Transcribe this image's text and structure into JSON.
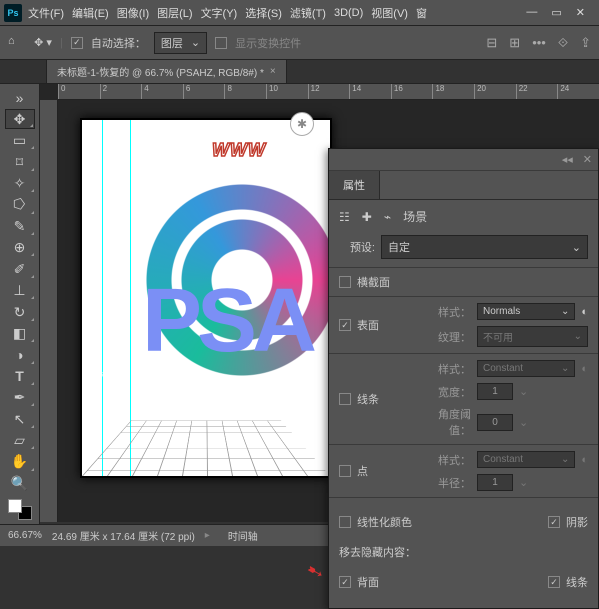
{
  "menu": {
    "file": "文件(F)",
    "edit": "编辑(E)",
    "image": "图像(I)",
    "layer": "图层(L)",
    "type": "文字(Y)",
    "select": "选择(S)",
    "filter": "滤镜(T)",
    "threeD": "3D(D)",
    "view": "视图(V)",
    "window": "窗"
  },
  "opt": {
    "autoSelect": "自动选择：",
    "target": "图层",
    "showTransform": "显示变换控件"
  },
  "tab": {
    "title": "未标题-1-恢复的 @ 66.7% (PSAHZ, RGB/8#) *"
  },
  "ruler": {
    "m": [
      "0",
      "2",
      "4",
      "6",
      "8",
      "10",
      "12",
      "14",
      "16",
      "18",
      "20",
      "22",
      "24"
    ]
  },
  "canvas": {
    "url": "WWW",
    "psa": "PSA",
    "spot": "✱"
  },
  "status": {
    "zoom": "66.67%",
    "dims": "24.69 厘米 x 17.64 厘米 (72 ppi)",
    "timeline": "时间轴"
  },
  "panel": {
    "title": "属性",
    "scene": "场景",
    "presetLabel": "预设:",
    "presetValue": "自定",
    "section": {
      "label": "横截面"
    },
    "surface": {
      "label": "表面",
      "styleLabel": "样式：",
      "styleValue": "Normals",
      "textureLabel": "纹理：",
      "textureValue": "不可用"
    },
    "lines": {
      "label": "线条",
      "styleLabel": "样式：",
      "styleValue": "Constant",
      "widthLabel": "宽度：",
      "widthValue": "1",
      "angleLabel": "角度阈值：",
      "angleValue": "0"
    },
    "points": {
      "label": "点",
      "styleLabel": "样式：",
      "styleValue": "Constant",
      "radiusLabel": "半径：",
      "radiusValue": "1"
    },
    "linearize": "线性化颜色",
    "shadow": "阴影",
    "hideLabel": "移去隐藏内容：",
    "backface": "背面",
    "linesBottom": "线条"
  }
}
